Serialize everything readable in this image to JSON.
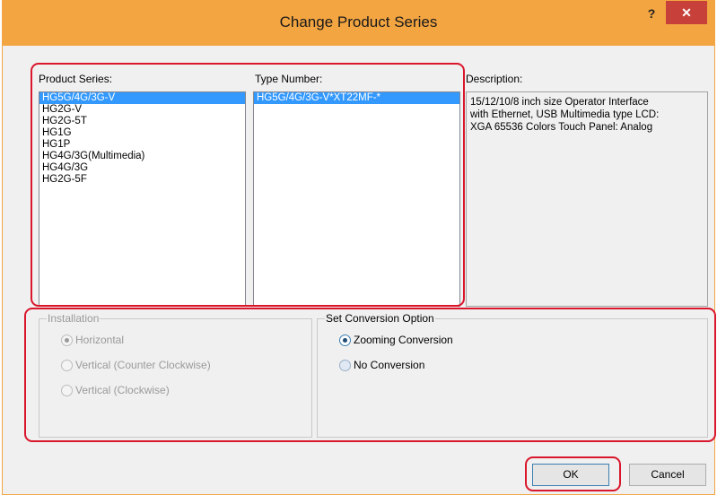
{
  "dialog": {
    "title": "Change Product Series",
    "help_label": "?",
    "close_label": "✕"
  },
  "product_series": {
    "label": "Product Series:",
    "items": [
      "HG5G/4G/3G-V",
      "HG2G-V",
      "HG2G-5T",
      "HG1G",
      "HG1P",
      "HG4G/3G(Multimedia)",
      "HG4G/3G",
      "HG2G-5F"
    ],
    "selected": "HG5G/4G/3G-V"
  },
  "type_number": {
    "label": "Type Number:",
    "items": [
      "HG5G/4G/3G-V*XT22MF-*"
    ],
    "selected": "HG5G/4G/3G-V*XT22MF-*"
  },
  "description": {
    "label": "Description:",
    "lines": [
      "15/12/10/8 inch size Operator Interface",
      "with Ethernet, USB Multimedia type LCD:",
      "XGA 65536 Colors Touch Panel: Analog"
    ]
  },
  "installation": {
    "title": "Installation",
    "enabled": false,
    "options": [
      {
        "label": "Horizontal",
        "checked": true
      },
      {
        "label": "Vertical (Counter Clockwise)",
        "checked": false
      },
      {
        "label": "Vertical (Clockwise)",
        "checked": false
      }
    ]
  },
  "conversion": {
    "title": "Set Conversion Option",
    "options": [
      {
        "label": "Zooming Conversion",
        "checked": true
      },
      {
        "label": "No Conversion",
        "checked": false
      }
    ]
  },
  "buttons": {
    "ok": "OK",
    "cancel": "Cancel"
  },
  "colors": {
    "title_bar": "#f3a541",
    "close_button": "#c7403a",
    "selection": "#3399ff",
    "highlight": "#d9162b"
  }
}
